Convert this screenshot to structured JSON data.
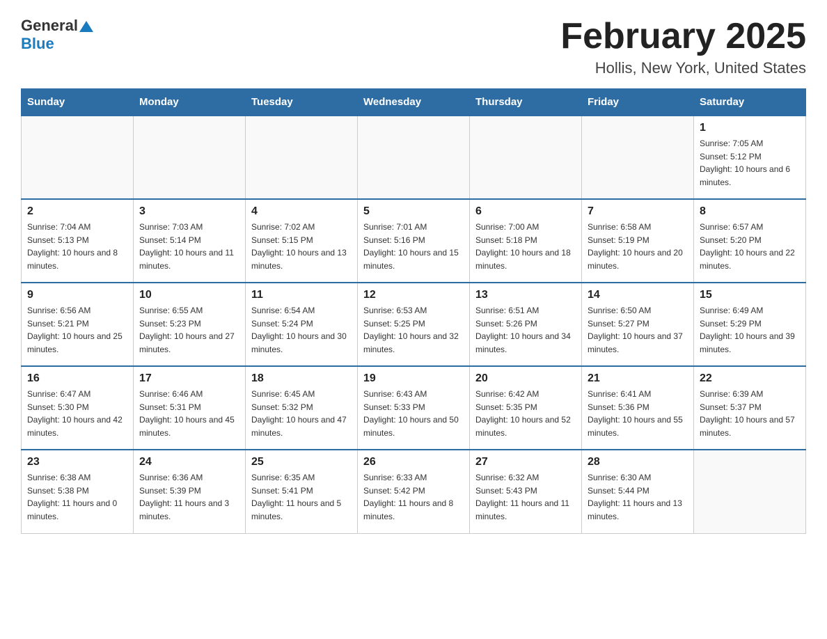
{
  "header": {
    "logo_general": "General",
    "logo_blue": "Blue",
    "month_year": "February 2025",
    "location": "Hollis, New York, United States"
  },
  "days_of_week": [
    "Sunday",
    "Monday",
    "Tuesday",
    "Wednesday",
    "Thursday",
    "Friday",
    "Saturday"
  ],
  "weeks": [
    {
      "days": [
        {
          "number": "",
          "info": ""
        },
        {
          "number": "",
          "info": ""
        },
        {
          "number": "",
          "info": ""
        },
        {
          "number": "",
          "info": ""
        },
        {
          "number": "",
          "info": ""
        },
        {
          "number": "",
          "info": ""
        },
        {
          "number": "1",
          "info": "Sunrise: 7:05 AM\nSunset: 5:12 PM\nDaylight: 10 hours and 6 minutes."
        }
      ]
    },
    {
      "days": [
        {
          "number": "2",
          "info": "Sunrise: 7:04 AM\nSunset: 5:13 PM\nDaylight: 10 hours and 8 minutes."
        },
        {
          "number": "3",
          "info": "Sunrise: 7:03 AM\nSunset: 5:14 PM\nDaylight: 10 hours and 11 minutes."
        },
        {
          "number": "4",
          "info": "Sunrise: 7:02 AM\nSunset: 5:15 PM\nDaylight: 10 hours and 13 minutes."
        },
        {
          "number": "5",
          "info": "Sunrise: 7:01 AM\nSunset: 5:16 PM\nDaylight: 10 hours and 15 minutes."
        },
        {
          "number": "6",
          "info": "Sunrise: 7:00 AM\nSunset: 5:18 PM\nDaylight: 10 hours and 18 minutes."
        },
        {
          "number": "7",
          "info": "Sunrise: 6:58 AM\nSunset: 5:19 PM\nDaylight: 10 hours and 20 minutes."
        },
        {
          "number": "8",
          "info": "Sunrise: 6:57 AM\nSunset: 5:20 PM\nDaylight: 10 hours and 22 minutes."
        }
      ]
    },
    {
      "days": [
        {
          "number": "9",
          "info": "Sunrise: 6:56 AM\nSunset: 5:21 PM\nDaylight: 10 hours and 25 minutes."
        },
        {
          "number": "10",
          "info": "Sunrise: 6:55 AM\nSunset: 5:23 PM\nDaylight: 10 hours and 27 minutes."
        },
        {
          "number": "11",
          "info": "Sunrise: 6:54 AM\nSunset: 5:24 PM\nDaylight: 10 hours and 30 minutes."
        },
        {
          "number": "12",
          "info": "Sunrise: 6:53 AM\nSunset: 5:25 PM\nDaylight: 10 hours and 32 minutes."
        },
        {
          "number": "13",
          "info": "Sunrise: 6:51 AM\nSunset: 5:26 PM\nDaylight: 10 hours and 34 minutes."
        },
        {
          "number": "14",
          "info": "Sunrise: 6:50 AM\nSunset: 5:27 PM\nDaylight: 10 hours and 37 minutes."
        },
        {
          "number": "15",
          "info": "Sunrise: 6:49 AM\nSunset: 5:29 PM\nDaylight: 10 hours and 39 minutes."
        }
      ]
    },
    {
      "days": [
        {
          "number": "16",
          "info": "Sunrise: 6:47 AM\nSunset: 5:30 PM\nDaylight: 10 hours and 42 minutes."
        },
        {
          "number": "17",
          "info": "Sunrise: 6:46 AM\nSunset: 5:31 PM\nDaylight: 10 hours and 45 minutes."
        },
        {
          "number": "18",
          "info": "Sunrise: 6:45 AM\nSunset: 5:32 PM\nDaylight: 10 hours and 47 minutes."
        },
        {
          "number": "19",
          "info": "Sunrise: 6:43 AM\nSunset: 5:33 PM\nDaylight: 10 hours and 50 minutes."
        },
        {
          "number": "20",
          "info": "Sunrise: 6:42 AM\nSunset: 5:35 PM\nDaylight: 10 hours and 52 minutes."
        },
        {
          "number": "21",
          "info": "Sunrise: 6:41 AM\nSunset: 5:36 PM\nDaylight: 10 hours and 55 minutes."
        },
        {
          "number": "22",
          "info": "Sunrise: 6:39 AM\nSunset: 5:37 PM\nDaylight: 10 hours and 57 minutes."
        }
      ]
    },
    {
      "days": [
        {
          "number": "23",
          "info": "Sunrise: 6:38 AM\nSunset: 5:38 PM\nDaylight: 11 hours and 0 minutes."
        },
        {
          "number": "24",
          "info": "Sunrise: 6:36 AM\nSunset: 5:39 PM\nDaylight: 11 hours and 3 minutes."
        },
        {
          "number": "25",
          "info": "Sunrise: 6:35 AM\nSunset: 5:41 PM\nDaylight: 11 hours and 5 minutes."
        },
        {
          "number": "26",
          "info": "Sunrise: 6:33 AM\nSunset: 5:42 PM\nDaylight: 11 hours and 8 minutes."
        },
        {
          "number": "27",
          "info": "Sunrise: 6:32 AM\nSunset: 5:43 PM\nDaylight: 11 hours and 11 minutes."
        },
        {
          "number": "28",
          "info": "Sunrise: 6:30 AM\nSunset: 5:44 PM\nDaylight: 11 hours and 13 minutes."
        },
        {
          "number": "",
          "info": ""
        }
      ]
    }
  ]
}
